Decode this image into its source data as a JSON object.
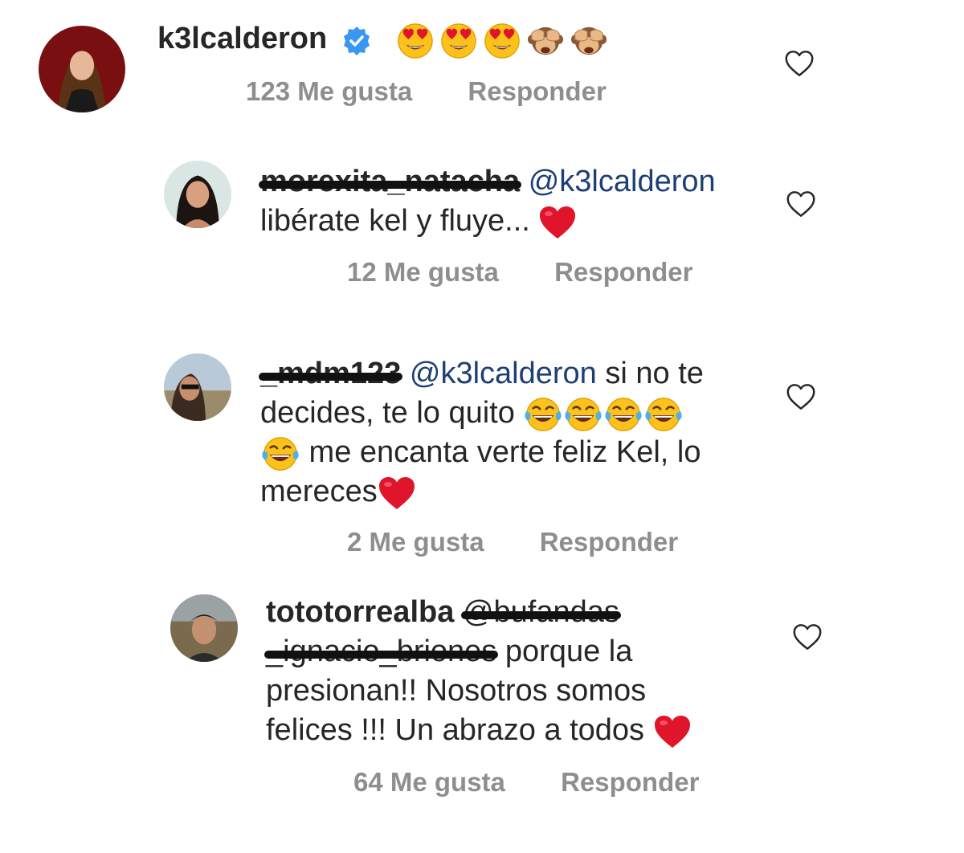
{
  "comments": [
    {
      "username": "k3lcalderon",
      "verified": true,
      "emojis": [
        "heart-eyes",
        "heart-eyes",
        "heart-eyes",
        "see-no-evil-monkey",
        "see-no-evil-monkey"
      ],
      "likes": "123 Me gusta",
      "reply": "Responder"
    },
    {
      "username": "morexita_natacha",
      "username_redacted": true,
      "mention": "@k3lcalderon",
      "line2": "libérate kel y fluye...",
      "likes": "12 Me gusta",
      "reply": "Responder"
    },
    {
      "username": "_mdm123",
      "username_redacted": true,
      "mention": "@k3lcalderon",
      "text1": " si no te",
      "text2": "decides, te lo quito",
      "text3": " me encanta verte feliz Kel, lo",
      "text4": "mereces",
      "likes": "2 Me gusta",
      "reply": "Responder"
    },
    {
      "username": "tototorrealba",
      "mention1": "@bufandas",
      "mention1_redacted": true,
      "mention2": "_ignacio_briones",
      "mention2_redacted": true,
      "text1": " porque la",
      "text2": "presionan!! Nosotros somos",
      "text3": "felices !!! Un abrazo a todos",
      "likes": "64 Me gusta",
      "reply": "Responder"
    }
  ],
  "colors": {
    "primary_text": "#262626",
    "secondary_text": "#8e8e8e",
    "mention": "#1d3f73",
    "verified_badge": "#3897f0",
    "heart_emoji": "#e0142a"
  },
  "icons": [
    "like-heart-outline-icon",
    "verified-badge-icon",
    "red-heart-emoji",
    "tears-of-joy-emoji",
    "heart-eyes-emoji",
    "see-no-evil-monkey-emoji"
  ]
}
